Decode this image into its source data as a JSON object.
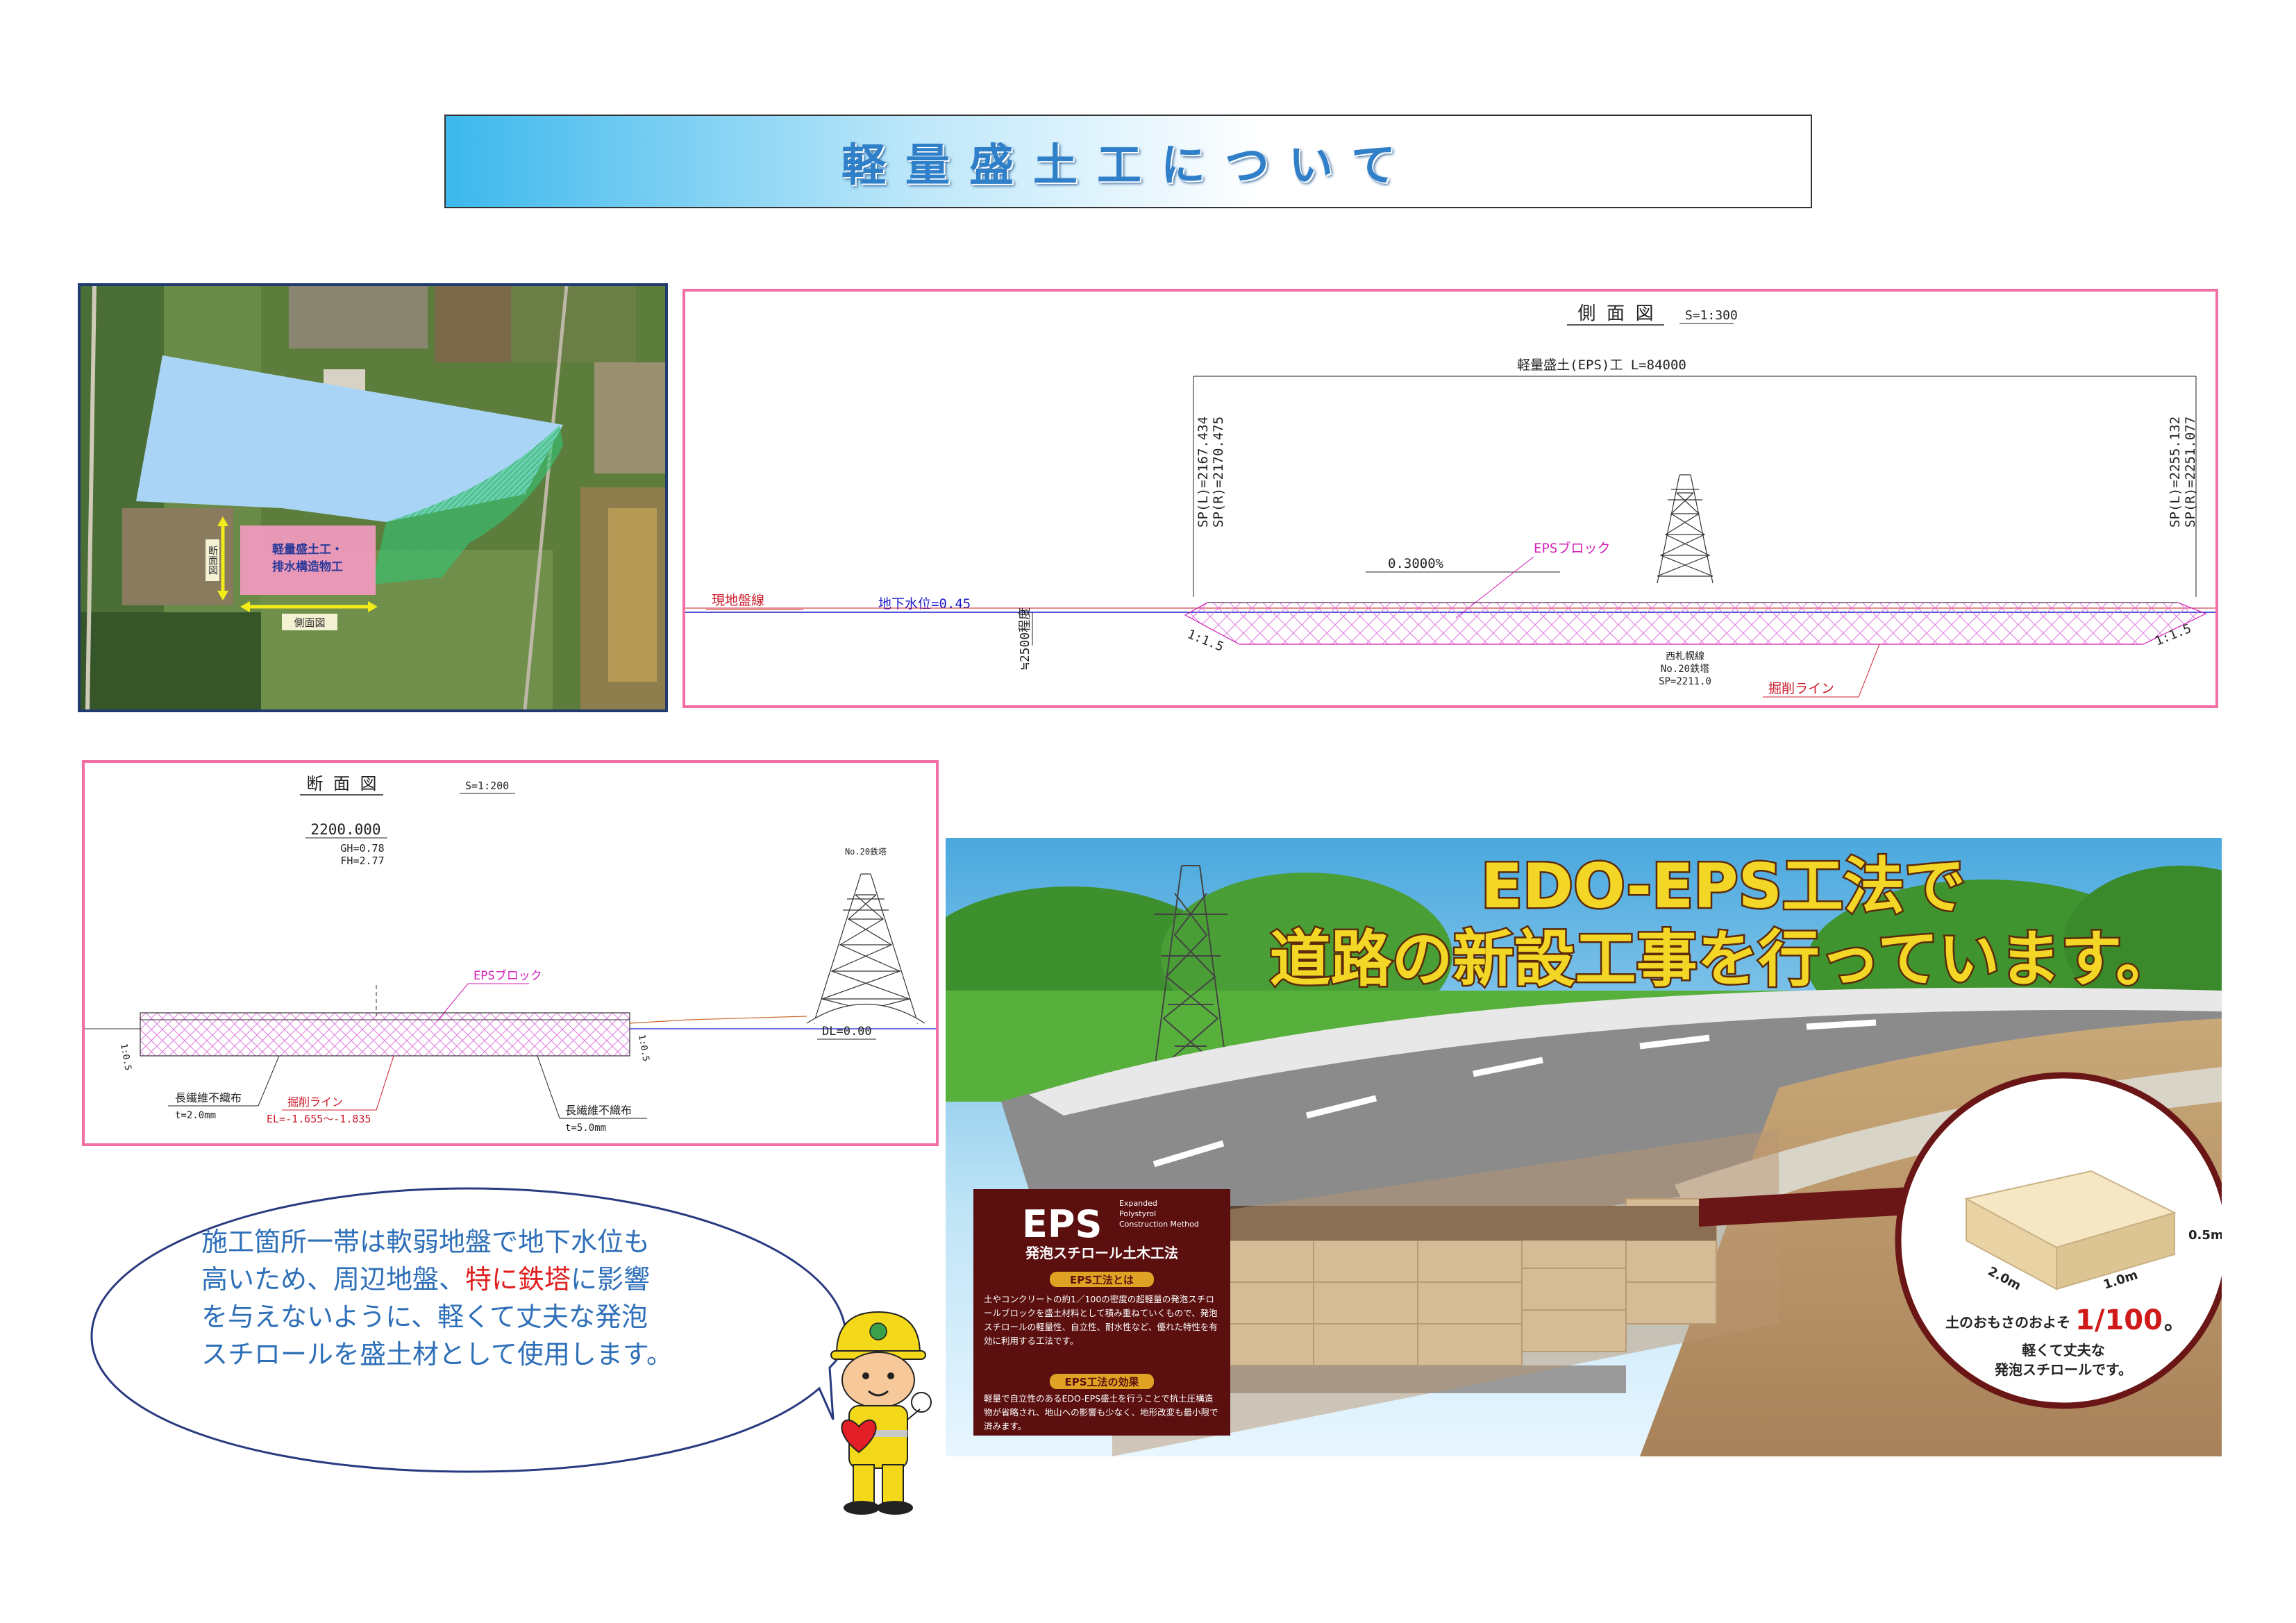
{
  "title": "軽量盛土工について",
  "aerial": {
    "label_works_1": "軽量盛土工・",
    "label_works_2": "排水構造物工",
    "label_cross": "断面図",
    "label_side": "側面図"
  },
  "side_view": {
    "title": "側 面 図",
    "scale": "S=1:300",
    "length_label": "軽量盛土(EPS)工 L=84000",
    "sp_left_l": "SP(L)=2167.434",
    "sp_left_r": "SP(R)=2170.475",
    "sp_right_l": "SP(L)=2255.132",
    "sp_right_r": "SP(R)=2251.077",
    "grade": "0.3000%",
    "eps_block": "EPSブロック",
    "ground_line": "現地盤線",
    "water_level": "地下水位=0.45",
    "depth": "≒2500程度",
    "slope_left": "1:1.5",
    "slope_right": "1:1.5",
    "tower_line": "西札幌線",
    "tower_no": "No.20鉄塔",
    "tower_sp": "SP=2211.0",
    "excavation": "掘削ライン"
  },
  "section_view": {
    "title": "断 面 図",
    "scale": "S=1:200",
    "station": "2200.000",
    "gh": "GH=0.78",
    "fh": "FH=2.77",
    "tower": "No.20鉄塔",
    "eps_block": "EPSブロック",
    "dl": "DL=0.00",
    "slope_left": "1:0.5",
    "slope_right": "1:0.5",
    "fabric_left": "長繊維不織布",
    "fabric_left_t": "t=2.0mm",
    "excavation": "掘削ライン",
    "el": "EL=-1.655〜-1.835",
    "fabric_right": "長繊維不織布",
    "fabric_right_t": "t=5.0mm"
  },
  "poster": {
    "headline_1": "EDO-EPS工法で",
    "headline_2": "道路の新設工事を行っています。",
    "eps_logo": "EPS",
    "eps_sub_1": "Expanded",
    "eps_sub_2": "Polystyrol",
    "eps_sub_3": "Construction Method",
    "eps_jp": "発泡スチロール土木工法",
    "about_header": "EPS工法とは",
    "about_body": "土やコンクリートの約1／100の密度の超軽量の発泡スチロールブロックを盛土材料として積み重ねていくもので、発泡スチロールの軽量性、自立性、耐水性など、優れた特性を有効に利用する工法です。",
    "effect_header": "EPS工法の効果",
    "effect_body": "軽量で自立性のあるEDO-EPS盛土を行うことで抗土圧構造物が省略され、地山への影響も少なく、地形改変も最小限で済みます。",
    "dim_h": "0.5m",
    "dim_l": "2.0m",
    "dim_w": "1.0m",
    "weight_pre": "土のおもさのおよそ",
    "weight_value": "1/100",
    "weight_post": "。",
    "light_1": "軽くて丈夫な",
    "light_2": "発泡スチロールです。"
  },
  "speech": {
    "line1": "施工箇所一帯は軟弱地盤で地下水位も",
    "line2": "高いため、周辺地盤、",
    "line2_highlight": "特に鉄塔",
    "line2_end": "に影響",
    "line3": "を与えないように、軽くて丈夫な発泡",
    "line4": "スチロールを盛土材として使用します。"
  }
}
